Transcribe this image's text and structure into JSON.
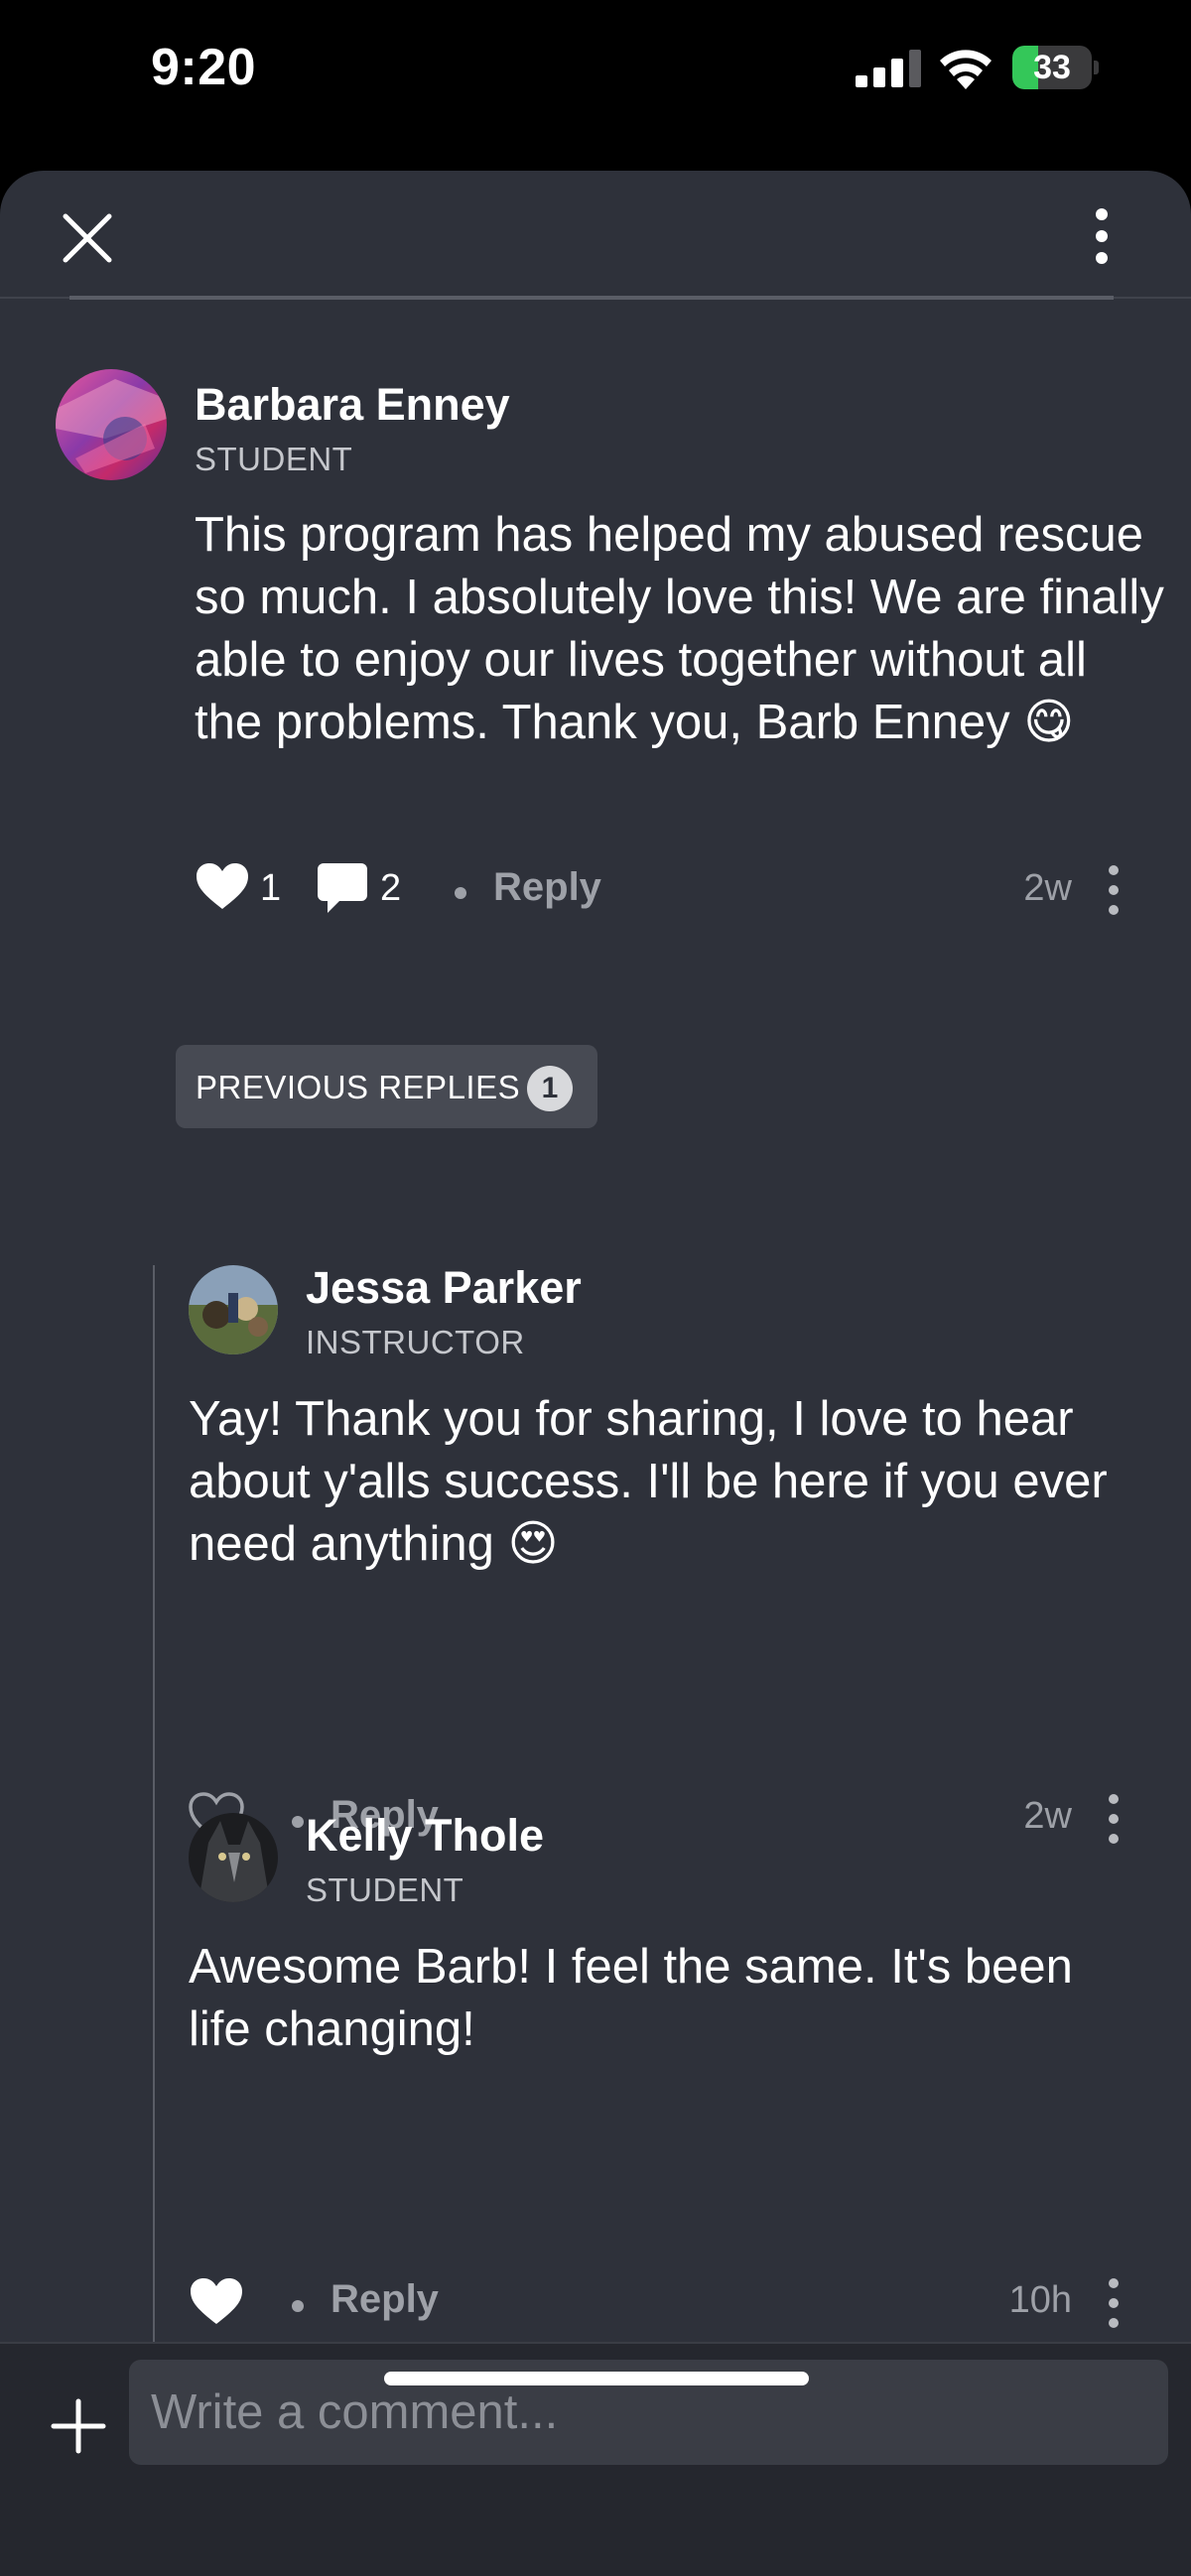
{
  "status": {
    "time": "9:20",
    "battery": "33",
    "battery_level": 0.33
  },
  "header": {
    "close_icon": "close-icon",
    "more_icon": "vertical-ellipsis-icon"
  },
  "post": {
    "author": "Barbara Enney",
    "role": "STUDENT",
    "text": "This program has helped my abused rescue so much. I absolutely love this! We are finally able to enjoy our lives together without all the problems. Thank you, Barb Enney 😋",
    "likes": "1",
    "comments": "2",
    "reply_label": "Reply",
    "time": "2w"
  },
  "previous_replies": {
    "label": "PREVIOUS REPLIES",
    "count": "1"
  },
  "replies": [
    {
      "author": "Jessa Parker",
      "role": "INSTRUCTOR",
      "text": "Yay! Thank you for sharing, I love to hear about y'alls success. I'll be here if you ever need anything 😍",
      "reply_label": "Reply",
      "time": "2w",
      "liked": false
    },
    {
      "author": "Kelly Thole",
      "role": "STUDENT",
      "text": "Awesome Barb! I feel the same. It's been life changing!",
      "reply_label": "Reply",
      "time": "10h",
      "liked": true
    }
  ],
  "composer": {
    "placeholder": "Write a comment..."
  },
  "colors": {
    "background": "#2e313a",
    "muted": "#9ea1a8",
    "badge": "#474a53",
    "battery": "#34c759"
  }
}
